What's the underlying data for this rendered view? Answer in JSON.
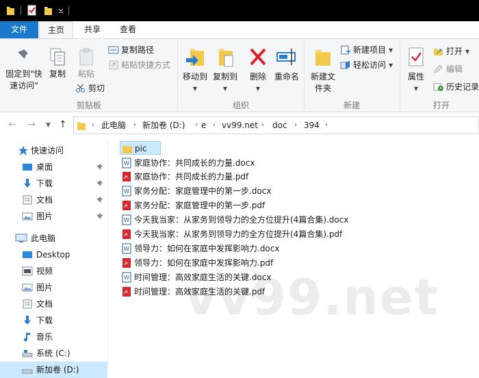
{
  "ribbon_tabs": {
    "file": "文件",
    "home": "主页",
    "share": "共享",
    "view": "查看"
  },
  "clipboard": {
    "pin_quick_access": "固定到\"快速访问\"",
    "copy": "复制",
    "paste": "粘贴",
    "copy_path": "复制路径",
    "paste_shortcut": "粘贴快捷方式",
    "cut": "剪切",
    "group_label": "剪贴板"
  },
  "organize": {
    "move_to": "移动到",
    "copy_to": "复制到",
    "delete": "删除",
    "rename": "重命名",
    "group_label": "组织"
  },
  "new_group": {
    "new_folder": "新建文件夹",
    "new_item": "新建项目",
    "easy_access": "轻松访问",
    "group_label": "新建"
  },
  "open_group": {
    "properties": "属性",
    "open": "打开",
    "edit": "编辑",
    "history": "历史记录",
    "group_label": "打开"
  },
  "breadcrumbs": [
    "此电脑",
    "新加卷 (D:)",
    "e",
    "vv99.net",
    "doc",
    "394"
  ],
  "nav_pane": {
    "quick_access": "快速访问",
    "quick_items": [
      "桌面",
      "下载",
      "文档",
      "图片"
    ],
    "this_pc": "此电脑",
    "pc_items": [
      "Desktop",
      "视频",
      "图片",
      "文档",
      "下载",
      "音乐",
      "系统 (C:)",
      "新加卷 (D:)"
    ]
  },
  "files": [
    {
      "name": "pic",
      "type": "folder"
    },
    {
      "name": "家庭协作：共同成长的力量.docx",
      "type": "docx"
    },
    {
      "name": "家庭协作：共同成长的力量.pdf",
      "type": "pdf"
    },
    {
      "name": "家务分配：家庭管理中的第一步.docx",
      "type": "docx"
    },
    {
      "name": "家务分配：家庭管理中的第一步.pdf",
      "type": "pdf"
    },
    {
      "name": "今天我当家：从家务到领导力的全方位提升(4篇合集).docx",
      "type": "docx"
    },
    {
      "name": "今天我当家：从家务到领导力的全方位提升(4篇合集).pdf",
      "type": "pdf"
    },
    {
      "name": "领导力：如何在家庭中发挥影响力.docx",
      "type": "docx"
    },
    {
      "name": "领导力：如何在家庭中发挥影响力.pdf",
      "type": "pdf"
    },
    {
      "name": "时间管理：高效家庭生活的关键.docx",
      "type": "docx"
    },
    {
      "name": "时间管理：高效家庭生活的关键.pdf",
      "type": "pdf"
    }
  ],
  "watermark": "vv99.net",
  "colors": {
    "accent": "#1979ca",
    "selection": "#cce8ff",
    "folder": "#f8d775",
    "pdf": "#d9262c",
    "docx": "#2b579a"
  }
}
